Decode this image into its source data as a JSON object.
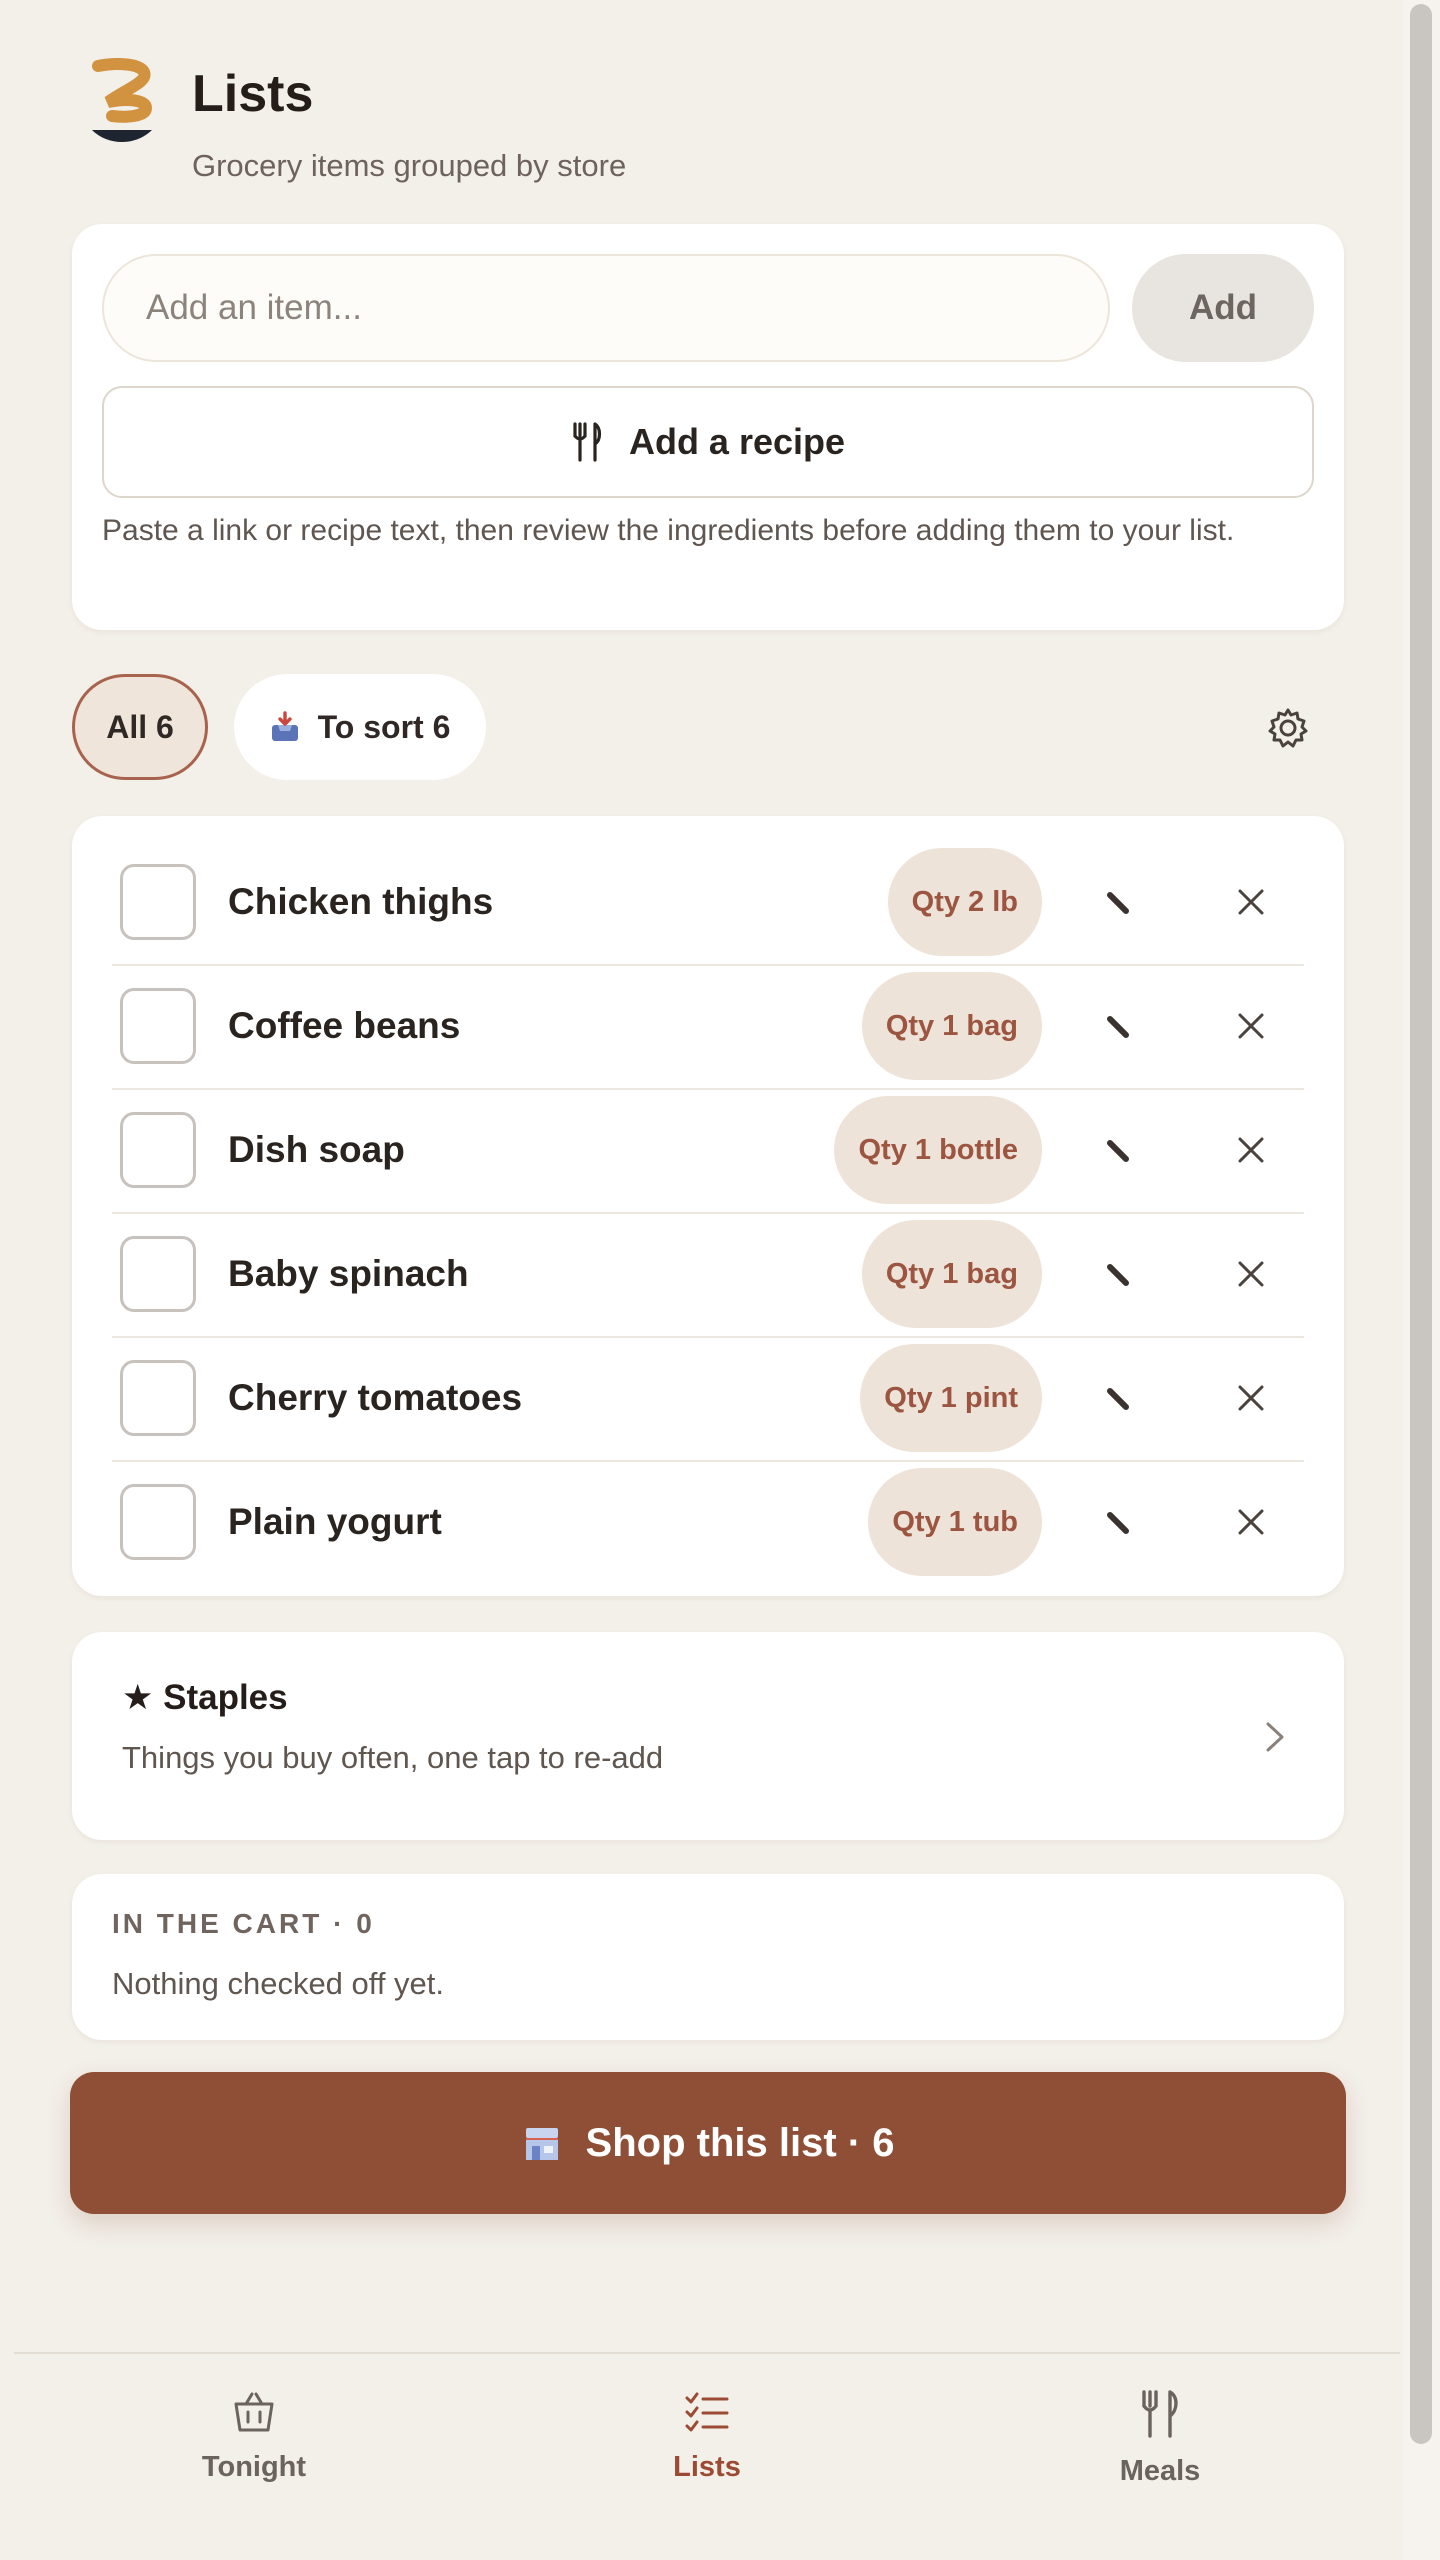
{
  "header": {
    "title": "Lists",
    "subtitle": "Grocery items grouped by store",
    "logo_icon": "swirl-bowl-logo"
  },
  "add_item": {
    "placeholder": "Add an item...",
    "value": "",
    "add_label": "Add",
    "recipe_label": "Add a recipe",
    "recipe_icon": "fork-knife-icon",
    "help_text": "Paste a link or recipe text, then review the ingredients before adding them to your list."
  },
  "filters": [
    {
      "label": "All 6",
      "selected": true
    },
    {
      "label": "To sort 6",
      "icon": "inbox-tray-icon",
      "selected": false
    }
  ],
  "settings_icon": "gear-icon",
  "items": [
    {
      "name": "Chicken thighs",
      "qty": "Qty 2 lb",
      "checked": false
    },
    {
      "name": "Coffee beans",
      "qty": "Qty 1 bag",
      "checked": false
    },
    {
      "name": "Dish soap",
      "qty": "Qty 1 bottle",
      "checked": false
    },
    {
      "name": "Baby spinach",
      "qty": "Qty 1 bag",
      "checked": false
    },
    {
      "name": "Cherry tomatoes",
      "qty": "Qty 1 pint",
      "checked": false
    },
    {
      "name": "Plain yogurt",
      "qty": "Qty 1 tub",
      "checked": false
    }
  ],
  "staples": {
    "title": "★ Staples",
    "subtitle": "Things you buy often, one tap to re-add"
  },
  "cart": {
    "title": "IN THE CART · 0",
    "message": "Nothing checked off yet."
  },
  "shop_button": {
    "label": "Shop this list · 6",
    "icon": "store-icon"
  },
  "nav": [
    {
      "label": "Tonight",
      "icon": "basket-icon",
      "active": false
    },
    {
      "label": "Lists",
      "icon": "checklist-icon",
      "active": true
    },
    {
      "label": "Meals",
      "icon": "fork-knife-icon",
      "active": false
    }
  ],
  "colors": {
    "background": "#f3efe9",
    "accent": "#8e4f36",
    "accent_text": "#9b4b33",
    "qty_pill": "#eee3d9",
    "card": "#ffffff"
  }
}
